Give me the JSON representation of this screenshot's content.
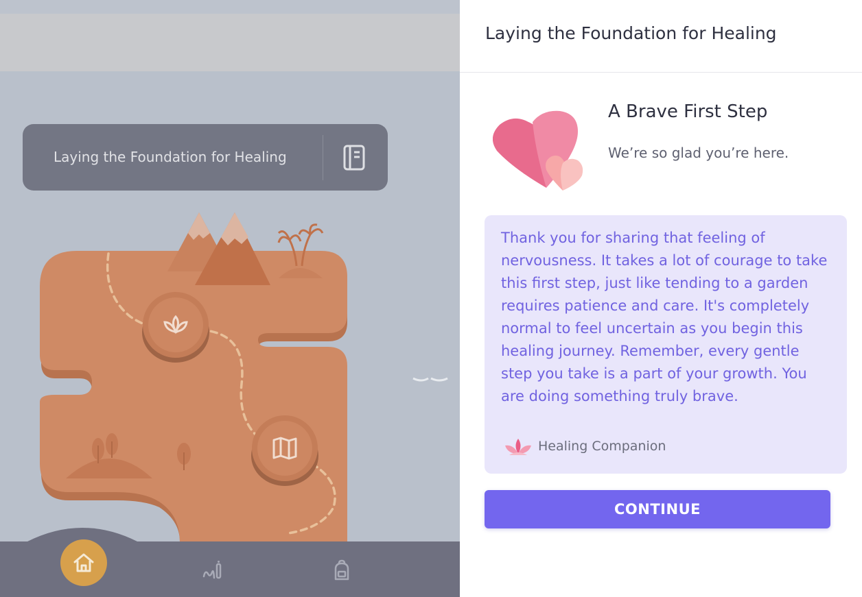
{
  "unit": {
    "title": "Laying the Foundation for Healing"
  },
  "drawer": {
    "title": "Laying the Foundation for Healing",
    "step_title": "A Brave First Step",
    "step_subtitle": "We’re so glad you’re here.",
    "message": "Thank you for sharing that feeling of nervousness. It takes a lot of courage to take this first step, just like tending to a garden requires patience and care. It's completely normal to feel uncertain as you begin this healing journey. Remember, every gentle step you take is a part of your growth. You are doing something truly brave.",
    "companion_name": "Healing Companion",
    "continue_label": "CONTINUE"
  },
  "nav": {
    "items": [
      {
        "icon": "home-icon",
        "active": true
      },
      {
        "icon": "journal-icon",
        "active": false
      },
      {
        "icon": "backpack-icon",
        "active": false
      }
    ]
  },
  "colors": {
    "accent": "#7366ee",
    "message_bg": "#e9e6fb",
    "message_text": "#7062e0",
    "nav_active": "#d7a04c",
    "island": "#cf8a65",
    "overlay_bg": "#b9c0cb"
  }
}
